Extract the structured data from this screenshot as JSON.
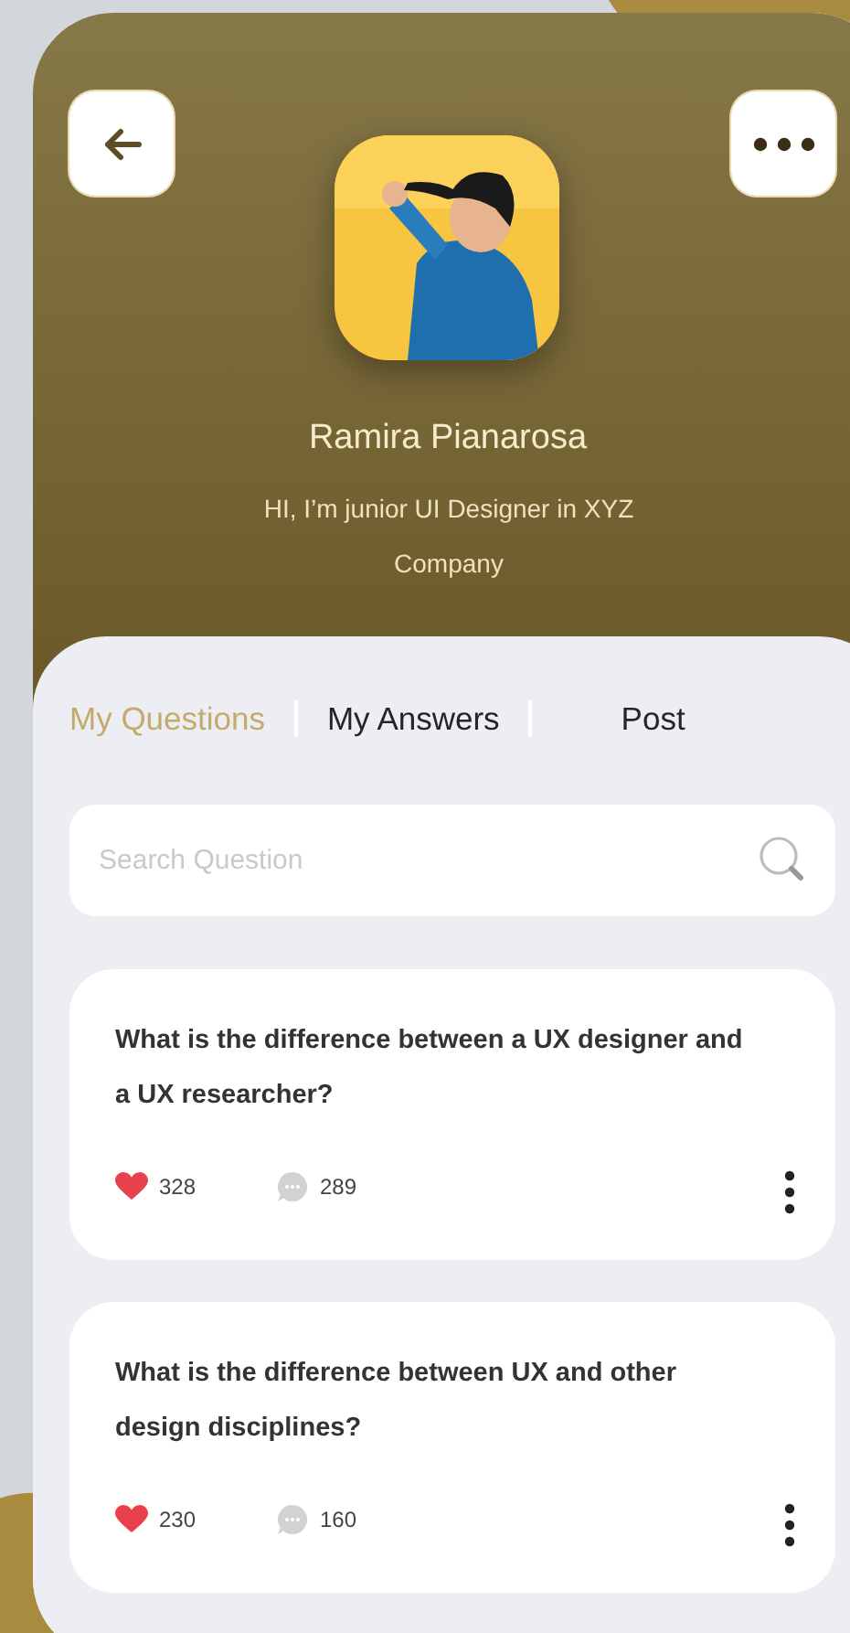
{
  "header": {
    "name": "Ramira Pianarosa",
    "bio": "HI, I’m junior UI Designer in XYZ Company"
  },
  "tabs": [
    {
      "label": "My Questions",
      "selected": true
    },
    {
      "label": "My Answers",
      "selected": false
    },
    {
      "label": "Post",
      "selected": false
    }
  ],
  "search": {
    "placeholder": "Search Question"
  },
  "questions": [
    {
      "text": "What is the difference between a UX designer and a UX researcher?",
      "likes": "328",
      "comments": "289"
    },
    {
      "text": "What is the difference between UX and other design disciplines?",
      "likes": "230",
      "comments": "160"
    }
  ]
}
